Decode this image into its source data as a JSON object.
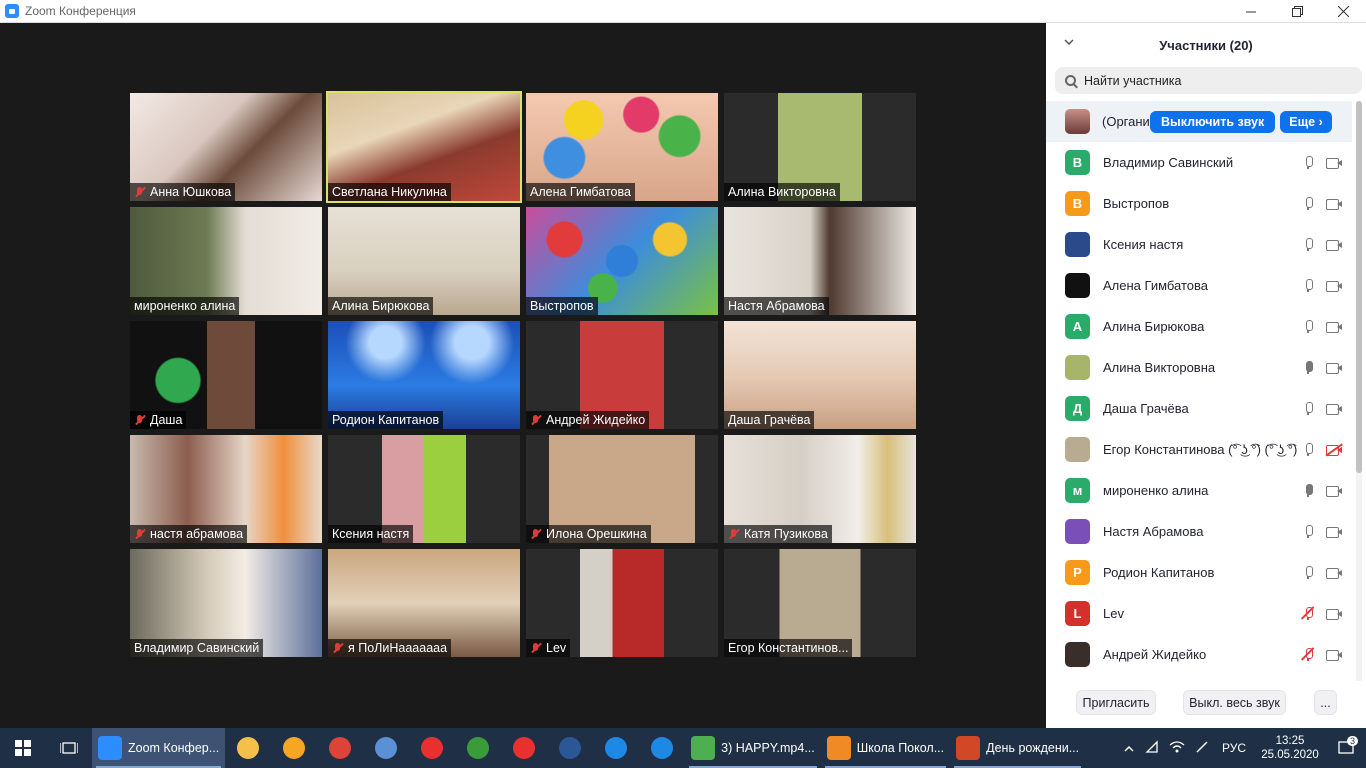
{
  "window": {
    "title": "Zoom Конференция"
  },
  "tiles": [
    {
      "name": "Анна Юшкова",
      "muted": true,
      "bg": "linear-gradient(135deg,#f3e9e4 0%,#d9c7bf 40%,#6b4b3a 60%,#e7d8d4 100%)",
      "active": false
    },
    {
      "name": "Светлана Никулина",
      "muted": false,
      "bg": "linear-gradient(160deg,#d9c29a 0%,#e9d6b8 35%,#8a3b2e 60%,#c2473b 100%)",
      "active": true
    },
    {
      "name": "Алена Гимбатова",
      "muted": false,
      "bg": "radial-gradient(circle at 30% 25%,#f5d21f 0 12%,transparent 13%),radial-gradient(circle at 60% 20%,#e23b6a 0 12%,transparent 13%),radial-gradient(circle at 80% 40%,#49b34a 0 12%,transparent 13%),radial-gradient(circle at 20% 60%,#3f8fe0 0 12%,transparent 13%),linear-gradient(#f4c9b0,#d8a68a)",
      "active": false
    },
    {
      "name": "Алина Викторовна",
      "muted": false,
      "bg": "linear-gradient(90deg,#2b2b2b 0 28%,#a8b970 28% 72%,#2b2b2b 72%)",
      "active": false
    },
    {
      "name": "мироненко алина",
      "muted": false,
      "bg": "linear-gradient(90deg,#4f5a3d 0%,#6d7a52 40%,#e4ddd5 60%,#f1ece6 100%)",
      "active": false
    },
    {
      "name": "Алина Бирюкова",
      "muted": false,
      "bg": "linear-gradient(180deg,#e7e1d5 0%,#d8cfbf 60%,#b9a88f 100%)",
      "active": false
    },
    {
      "name": "Выстропов",
      "muted": false,
      "bg": "radial-gradient(circle at 20% 30%,#e23b3b 0 10%,transparent 11%),radial-gradient(circle at 50% 50%,#2f7fd8 0 14%,transparent 15%),radial-gradient(circle at 75% 30%,#f5c431 0 10%,transparent 11%),radial-gradient(circle at 40% 75%,#49b34a 0 10%,transparent 11%),linear-gradient(135deg,#c84d9c,#3c8ddc 50%,#7ac143)",
      "active": false
    },
    {
      "name": "Настя Абрамова",
      "muted": false,
      "bg": "linear-gradient(90deg,#e9e4dd 0%,#d8d2c9 45%,#4e3a30 55%,#efeae4 100%)",
      "active": false
    },
    {
      "name": "Даша",
      "muted": true,
      "bg": "radial-gradient(circle at 25% 55%,#2fa84f 0 14%,transparent 15%),linear-gradient(90deg,#111 0 40%,#6d4a3a 40% 65%,#111 65%)",
      "active": false
    },
    {
      "name": "Родион Капитанов",
      "muted": false,
      "bg": "radial-gradient(circle at 30% 20%,#b6d8ff 0 10%,transparent 25%),radial-gradient(circle at 75% 20%,#b6d8ff 0 10%,transparent 25%),linear-gradient(180deg,#1c4fb8 0%,#2b7ce3 60%,#1a3f96 100%)",
      "active": false
    },
    {
      "name": "Андрей Жидейко",
      "muted": true,
      "bg": "linear-gradient(90deg,#2b2b2b 0 28%,#c93c3c 28% 72%,#2b2b2b 72%)",
      "active": false
    },
    {
      "name": "Даша Грачёва",
      "muted": false,
      "bg": "linear-gradient(180deg,#f3e3d6 0%,#e6cbb6 50%,#c99f82 100%)",
      "active": false
    },
    {
      "name": "настя абрамова",
      "muted": true,
      "bg": "linear-gradient(90deg,#c8b9ad 0%,#8c5d4e 30%,#e6d6c8 60%,#f08f3c 80%,#e8d9cc 100%)",
      "active": false
    },
    {
      "name": "Ксения настя",
      "muted": false,
      "bg": "linear-gradient(90deg,#2b2b2b 0 28%,#d89ea2 28% 50%,#9ccf3f 50% 72%,#2b2b2b 72%)",
      "active": false
    },
    {
      "name": "Илона Орешкина",
      "muted": true,
      "bg": "linear-gradient(90deg,#2b2b2b 0 12%,#c9a88a 12% 88%,#2b2b2b 88%)",
      "active": false
    },
    {
      "name": "Катя Пузикова",
      "muted": true,
      "bg": "linear-gradient(90deg,#e6e0d8 0%,#d6cfc6 40%,#f1ede8 70%,#d7c07a 85%,#e8e3dd 100%)",
      "active": false
    },
    {
      "name": "Владимир Савинский",
      "muted": false,
      "bg": "linear-gradient(90deg,#6b6a5c 0%,#d5cab8 40%,#f2ece4 60%,#5b6f9a 100%)",
      "active": false
    },
    {
      "name": "я ПоЛиНааааааа",
      "muted": true,
      "bg": "linear-gradient(180deg,#c9a77f 0%,#e2d0b8 50%,#7a5a44 100%)",
      "active": false
    },
    {
      "name": "Lev",
      "muted": true,
      "bg": "linear-gradient(90deg,#2b2b2b 0 28%,#d4d0c8 28% 45%,#b82a2a 45% 72%,#2b2b2b 72%)",
      "active": false
    },
    {
      "name": "Егор Константинов...",
      "muted": false,
      "bg": "linear-gradient(90deg,#2b2b2b 0 29%,#b9aa92 29% 71%,#2b2b2b 71%)",
      "active": false
    }
  ],
  "panel": {
    "title": "Участники (20)",
    "search_placeholder": "Найти участника",
    "host": {
      "name": "(Организатор)",
      "unmute_label": "Выключить звук",
      "more_label": "Еще ›"
    },
    "participants": [
      {
        "name": "Владимир Савинский",
        "initial": "В",
        "color": "#2bab6a",
        "mic": "idle",
        "cam": "on"
      },
      {
        "name": "Выстропов",
        "initial": "В",
        "color": "#f79a1a",
        "mic": "idle",
        "cam": "on"
      },
      {
        "name": "Ксения настя",
        "initial": "",
        "color": "#2a4a8a",
        "mic": "idle",
        "cam": "on"
      },
      {
        "name": "Алена Гимбатова",
        "initial": "",
        "color": "#111111",
        "mic": "idle",
        "cam": "on"
      },
      {
        "name": "Алина Бирюкова",
        "initial": "А",
        "color": "#2bab6a",
        "mic": "idle",
        "cam": "on"
      },
      {
        "name": "Алина Викторовна",
        "initial": "",
        "color": "#a7b56a",
        "mic": "on",
        "cam": "on"
      },
      {
        "name": "Даша Грачёва",
        "initial": "Д",
        "color": "#2bab6a",
        "mic": "idle",
        "cam": "on"
      },
      {
        "name": "Егор Константинова (͡° ͜ʖ ͡°) (͡° ͜ʖ ͡°)",
        "initial": "",
        "color": "#b9aa92",
        "mic": "idle",
        "cam": "off"
      },
      {
        "name": "мироненко алина",
        "initial": "м",
        "color": "#2bab6a",
        "mic": "on",
        "cam": "on"
      },
      {
        "name": "Настя Абрамова",
        "initial": "",
        "color": "#7a4fb8",
        "mic": "idle",
        "cam": "on"
      },
      {
        "name": "Родион Капитанов",
        "initial": "Р",
        "color": "#f79a1a",
        "mic": "idle",
        "cam": "on"
      },
      {
        "name": "Lev",
        "initial": "L",
        "color": "#d5312c",
        "mic": "off",
        "cam": "on"
      },
      {
        "name": "Андрей Жидейко",
        "initial": "",
        "color": "#3a2e2a",
        "mic": "off",
        "cam": "on"
      }
    ],
    "invite_label": "Пригласить",
    "mute_all_label": "Выкл. весь звук",
    "more_dots": "..."
  },
  "taskbar": {
    "apps": [
      {
        "label": "Zoom Конфер...",
        "icon_color": "#2d8cff",
        "active": true
      },
      {
        "label": "3) HAPPY.mp4...",
        "icon_color": "#4caf50",
        "active": false
      },
      {
        "label": "Школа Покол...",
        "icon_color": "#f08a24",
        "active": false
      },
      {
        "label": "День рождени...",
        "icon_color": "#d24726",
        "active": false
      }
    ],
    "pinned": [
      {
        "icon": "folder-icon",
        "color": "#f5c04a"
      },
      {
        "icon": "app-icon",
        "color": "#f5a623"
      },
      {
        "icon": "chrome-icon",
        "color": "#db4437"
      },
      {
        "icon": "app-icon",
        "color": "#5b8fd6"
      },
      {
        "icon": "yandex-browser-icon",
        "color": "#e9302f"
      },
      {
        "icon": "app-icon",
        "color": "#3a9b3a"
      },
      {
        "icon": "yandex-icon",
        "color": "#e9302f"
      },
      {
        "icon": "word-icon",
        "color": "#2b5797"
      },
      {
        "icon": "mail-icon",
        "color": "#1e88e5"
      },
      {
        "icon": "edge-icon",
        "color": "#1e88e5"
      }
    ],
    "lang": "РУС",
    "time": "13:25",
    "date": "25.05.2020",
    "notifications": "3"
  }
}
